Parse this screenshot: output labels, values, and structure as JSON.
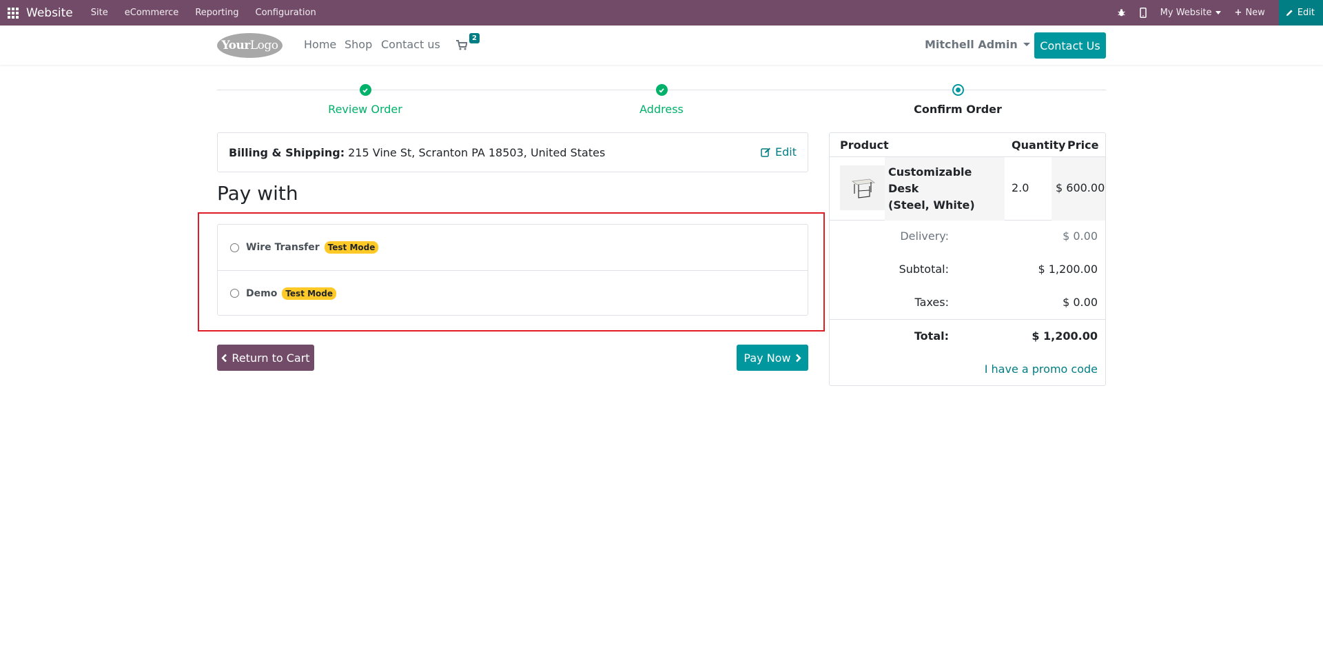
{
  "admin_bar": {
    "brand": "Website",
    "menus": [
      "Site",
      "eCommerce",
      "Reporting",
      "Configuration"
    ],
    "website_selector": "My Website",
    "new_label": "New",
    "edit_label": "Edit"
  },
  "header": {
    "logo_text_bold": "Your",
    "logo_text_light": "Logo",
    "nav": [
      "Home",
      "Shop",
      "Contact us"
    ],
    "cart_count": "2",
    "user_name": "Mitchell Admin",
    "contact_button": "Contact Us"
  },
  "wizard": {
    "steps": [
      {
        "label": "Review Order",
        "state": "done"
      },
      {
        "label": "Address",
        "state": "done"
      },
      {
        "label": "Confirm Order",
        "state": "current"
      }
    ]
  },
  "billing": {
    "label": "Billing & Shipping:",
    "address": "215 Vine St, Scranton PA 18503, United States",
    "edit_label": "Edit"
  },
  "payment": {
    "title": "Pay with",
    "methods": [
      {
        "name": "Wire Transfer",
        "badge": "Test Mode",
        "selected": false
      },
      {
        "name": "Demo",
        "badge": "Test Mode",
        "selected": false
      }
    ],
    "return_label": "Return to Cart",
    "pay_label": "Pay Now"
  },
  "summary": {
    "headers": {
      "product": "Product",
      "quantity": "Quantity",
      "price": "Price"
    },
    "product": {
      "name_line1": "Customizable Desk",
      "name_line2": "(Steel, White)",
      "quantity": "2.0",
      "price": "$ 600.00"
    },
    "delivery_label": "Delivery:",
    "delivery_value": "$ 0.00",
    "subtotal_label": "Subtotal:",
    "subtotal_value": "$ 1,200.00",
    "taxes_label": "Taxes:",
    "taxes_value": "$ 0.00",
    "total_label": "Total:",
    "total_value": "$ 1,200.00",
    "promo_label": "I have a promo code"
  },
  "colors": {
    "admin_bar": "#714b67",
    "primary": "#01979f",
    "success": "#00b16a",
    "badge": "#ffca28",
    "highlight": "#e01b24"
  }
}
